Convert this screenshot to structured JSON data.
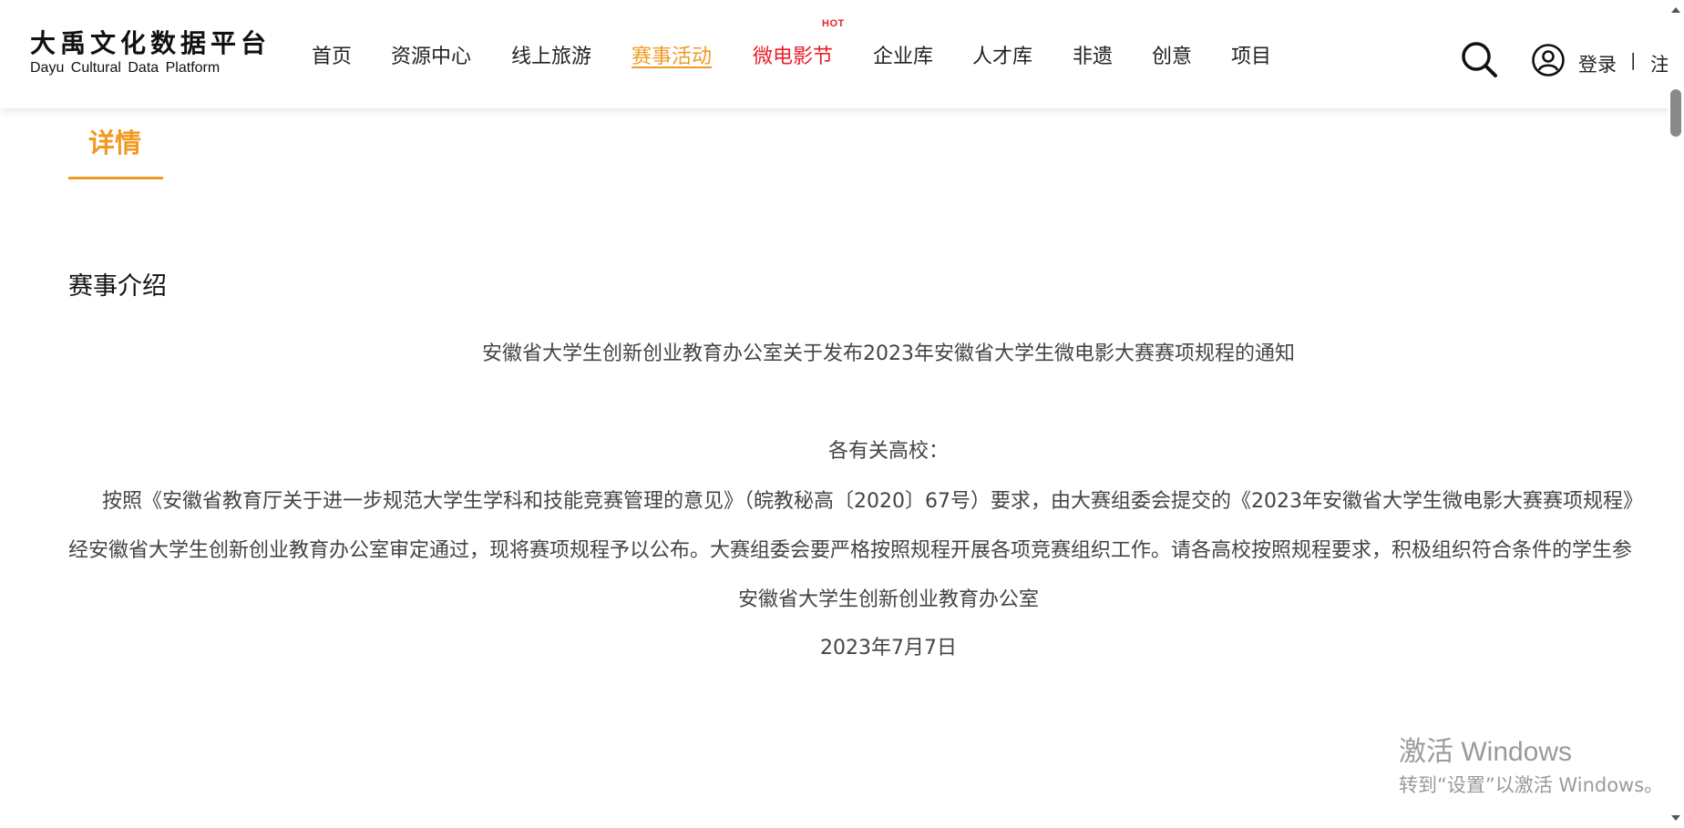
{
  "logo": {
    "cn": "大禹文化数据平台",
    "en": "Dayu Cultural Data Platform"
  },
  "nav": {
    "items": [
      {
        "label": "首页"
      },
      {
        "label": "资源中心"
      },
      {
        "label": "线上旅游"
      },
      {
        "label": "赛事活动",
        "state": "active"
      },
      {
        "label": "微电影节",
        "state": "hot"
      },
      {
        "label": "企业库"
      },
      {
        "label": "人才库"
      },
      {
        "label": "非遗"
      },
      {
        "label": "创意"
      },
      {
        "label": "项目"
      }
    ],
    "hot_badge": "HOT"
  },
  "auth": {
    "login": "登录",
    "divider": "|",
    "register": "注"
  },
  "tab": {
    "label": "详情"
  },
  "section": {
    "title": "赛事介绍"
  },
  "article": {
    "heading": "安徽省大学生创新创业教育办公室关于发布2023年安徽省大学生微电影大赛赛项规程的通知",
    "salutation": "各有关高校：",
    "para1": "按照《安徽省教育厅关于进一步规范大学生学科和技能竞赛管理的意见》（皖教秘高〔2020〕67号）要求，由大赛组委会提交的《2023年安徽省大学生微电影大赛赛项规程》",
    "para2": "经安徽省大学生创新创业教育办公室审定通过，现将赛项规程予以公布。大赛组委会要严格按照规程开展各项竞赛组织工作。请各高校按照规程要求，积极组织符合条件的学生参",
    "signature": "安徽省大学生创新创业教育办公室",
    "date": "2023年7月7日"
  },
  "watermark": {
    "title": "激活 Windows",
    "subtitle": "转到“设置”以激活 Windows。"
  },
  "colors": {
    "accent": "#f09a24",
    "hot": "#e8202a",
    "text": "#444444"
  }
}
